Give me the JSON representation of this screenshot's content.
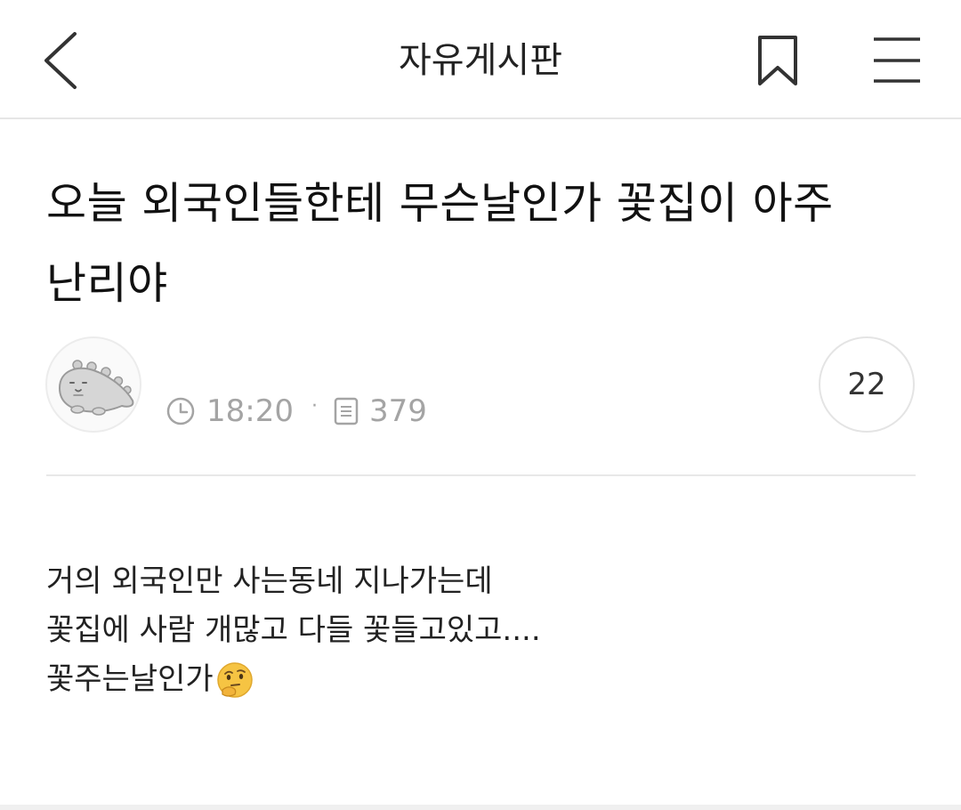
{
  "header": {
    "title": "자유게시판"
  },
  "post": {
    "title": "오늘 외국인들한테 무슨날인가 꽃집이 아주 난리야",
    "time": "18:20",
    "separator": "·",
    "views": "379",
    "comment_count": "22",
    "body_lines": [
      "거의 외국인만 사는동네 지나가는데",
      "꽃집에 사람 개많고 다들 꽃들고있고....",
      "꽃주는날인가"
    ]
  },
  "icons": {
    "back": "chevron-left-icon",
    "bookmark": "bookmark-icon",
    "menu": "hamburger-menu-icon",
    "clock": "clock-icon",
    "views": "document-icon",
    "emoji": "thinking-face-emoji"
  },
  "colors": {
    "meta_gray": "#a4a4a4",
    "divider": "#e8e8e8",
    "text": "#222222"
  }
}
